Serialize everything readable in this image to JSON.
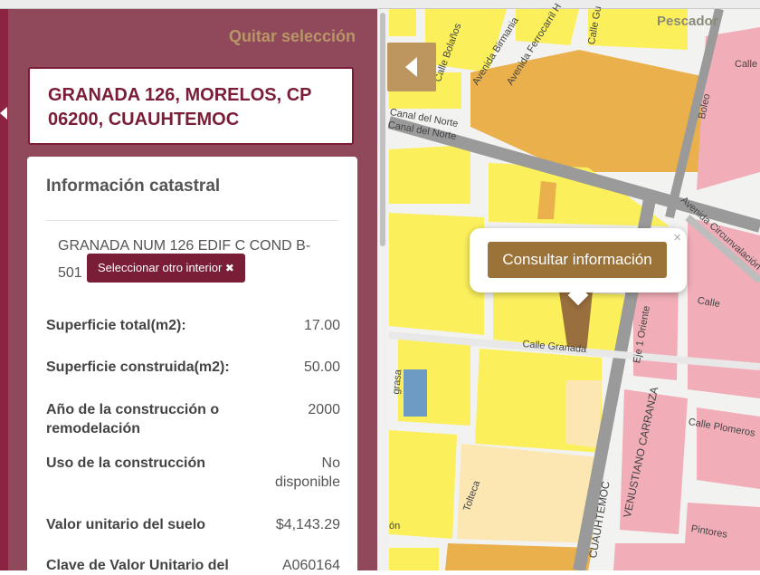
{
  "panel": {
    "quitar_label": "Quitar selección",
    "address": "GRANADA 126, MORELOS, CP 06200, CUAUHTEMOC",
    "info_title": "Información catastral",
    "condominio": "GRANADA NUM 126 EDIF C COND B-501",
    "otro_interior_label": "Seleccionar otro interior",
    "close_glyph": "✖",
    "rows": [
      {
        "label": "Superficie total(m2):",
        "value": "17.00"
      },
      {
        "label": "Superficie construida(m2):",
        "value": "50.00"
      },
      {
        "label": "Año de la construcción o remodelación",
        "value": "2000"
      },
      {
        "label": "Uso de la construcción",
        "value": "No disponible"
      },
      {
        "label": "Valor unitario del suelo",
        "value": "$4,143.29"
      },
      {
        "label": "Clave de Valor Unitario del Suelo (VUS)",
        "value": "A060164"
      }
    ]
  },
  "popup": {
    "button_label": "Consultar información",
    "close_glyph": "×"
  },
  "map": {
    "labels": {
      "pescador": "Pescador",
      "calle_top": "Calle",
      "bolanos": "Calle Bolaños",
      "birmania": "Avenida Birmania",
      "ferrocarril": "Avenida Ferrocarril H",
      "gu": "Calle Gu",
      "canal1": "Canal del Norte",
      "canal2": "Canal del Norte",
      "boleo": "Boleo",
      "circunvalacion": "Avenida Circunvalación",
      "calle_right": "Calle",
      "granada": "Calle Granada",
      "eje": "Eje 1 Oriente",
      "carranza": "VENUSTIANO CARRANZA",
      "cuauhtemoc": "CUAUHTEMOC",
      "plomeros": "Calle Plomeros",
      "pintores": "Pintores",
      "tolteca": "Tolteca",
      "on": "ón",
      "fragmento": "grasa"
    },
    "colors": {
      "yellow": "#fbf05c",
      "orange": "#e9b04c",
      "pink": "#f1aeb8",
      "beige": "#fce7b2",
      "road": "#9a9a9a",
      "street": "#e8e8e8",
      "selected": "#9a6f3e",
      "blue": "#6e9bc4",
      "accent": "#7a1d36",
      "gold": "#bc955f"
    }
  }
}
